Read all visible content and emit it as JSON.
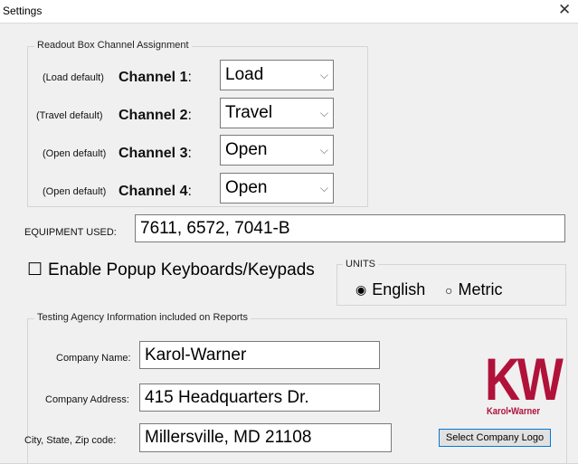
{
  "window": {
    "title": "Settings",
    "close_glyph": "✕"
  },
  "readout": {
    "legend": "Readout Box Channel Assignment",
    "channels": [
      {
        "default_label": "(Load default)",
        "channel_label": "Channel 1",
        "value": "Load"
      },
      {
        "default_label": "(Travel default)",
        "channel_label": "Channel 2",
        "value": "Travel"
      },
      {
        "default_label": "(Open default)",
        "channel_label": "Channel 3",
        "value": "Open"
      },
      {
        "default_label": "(Open default)",
        "channel_label": "Channel 4",
        "value": "Open"
      }
    ]
  },
  "equipment": {
    "label": "EQUIPMENT USED:",
    "value": "7611, 6572, 7041-B"
  },
  "popup": {
    "checked": false,
    "label": "Enable Popup Keyboards/Keypads"
  },
  "units": {
    "legend": "UNITS",
    "options": [
      "English",
      "Metric"
    ],
    "selected": "English"
  },
  "agency": {
    "legend": "Testing Agency Information included on Reports",
    "company_name_label": "Company Name:",
    "company_name": "Karol-Warner",
    "company_address_label": "Company Address:",
    "company_address": "415 Headquarters Dr.",
    "city_label": "City, State, Zip code:",
    "city": "Millersville, MD 21108",
    "logo_button": "Select Company Logo"
  },
  "logo": {
    "letters": "KW",
    "name": "Karol•Warner",
    "color": "#b0123a"
  }
}
